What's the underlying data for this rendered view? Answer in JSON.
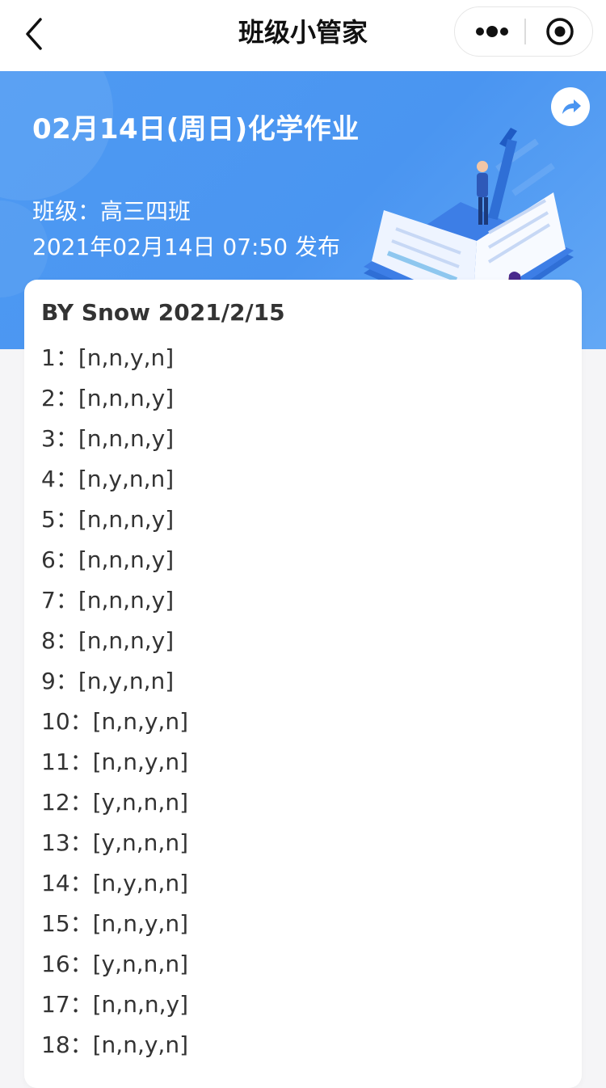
{
  "navbar": {
    "title": "班级小管家"
  },
  "banner": {
    "title": "02月14日(周日)化学作业",
    "class_label": "班级：高三四班",
    "publish_text": "2021年02月14日 07:50 发布"
  },
  "card": {
    "author_line": "BY Snow 2021/2/15",
    "answers": [
      "1：[n,n,y,n]",
      "2：[n,n,n,y]",
      "3：[n,n,n,y]",
      "4：[n,y,n,n]",
      "5：[n,n,n,y]",
      "6：[n,n,n,y]",
      "7：[n,n,n,y]",
      "8：[n,n,n,y]",
      "9：[n,y,n,n]",
      "10：[n,n,y,n]",
      "11：[n,n,y,n]",
      "12：[y,n,n,n]",
      "13：[y,n,n,n]",
      "14：[n,y,n,n]",
      "15：[n,n,y,n]",
      "16：[y,n,n,n]",
      "17：[n,n,n,y]",
      "18：[n,n,y,n]"
    ]
  },
  "icons": {
    "back": "chevron-left-icon",
    "more": "more-dots-icon",
    "close": "target-circle-icon",
    "share": "share-arrow-icon"
  },
  "colors": {
    "banner_blue": "#4a95f1",
    "card_bg": "#ffffff",
    "page_bg": "#f5f5f7",
    "text_dark": "#333333"
  }
}
